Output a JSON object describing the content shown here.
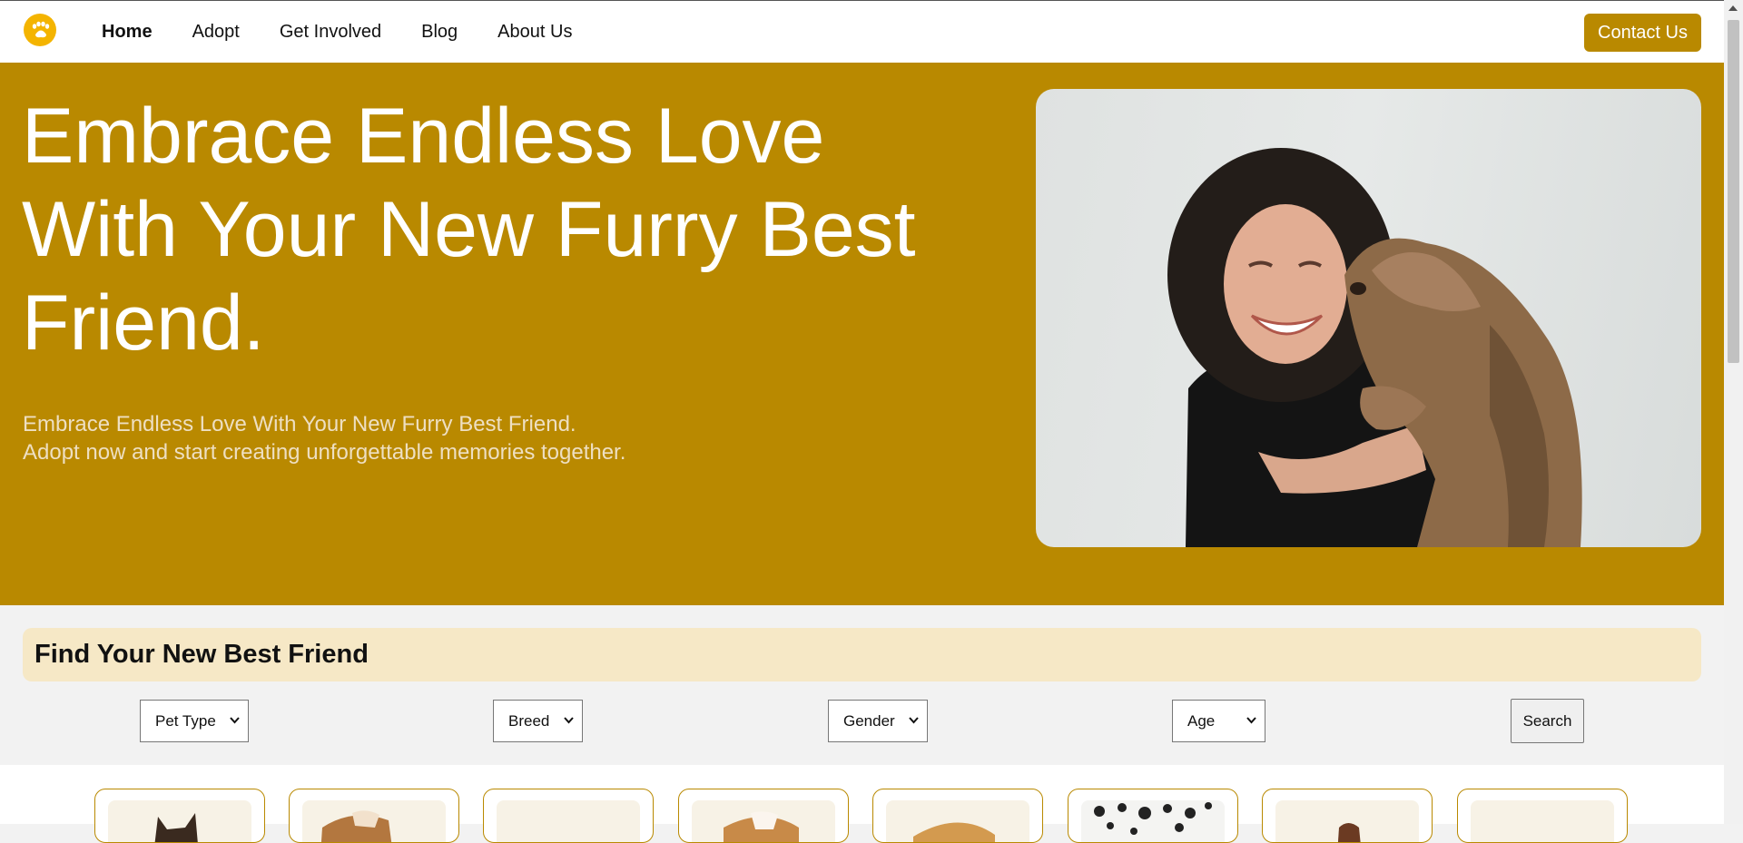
{
  "nav": {
    "logo_icon": "paw-icon",
    "links": [
      {
        "label": "Home",
        "active": true
      },
      {
        "label": "Adopt",
        "active": false
      },
      {
        "label": "Get Involved",
        "active": false
      },
      {
        "label": "Blog",
        "active": false
      },
      {
        "label": "About Us",
        "active": false
      }
    ],
    "contact_label": "Contact Us"
  },
  "hero": {
    "title": "Embrace Endless Love With Your New Furry Best Friend.",
    "subtitle_line1": "Embrace Endless Love With Your New Furry Best Friend.",
    "subtitle_line2": "Adopt now and start creating unforgettable memories together.",
    "photo": "woman-with-dog-photo"
  },
  "finder": {
    "title": "Find Your New Best Friend",
    "filters": [
      {
        "selected": "Pet Type"
      },
      {
        "selected": "Breed"
      },
      {
        "selected": "Gender"
      },
      {
        "selected": "Age"
      }
    ],
    "search_label": "Search"
  },
  "pet_cards": [
    {
      "image": "dog-photo-1"
    },
    {
      "image": "dog-photo-2"
    },
    {
      "image": "dog-photo-3"
    },
    {
      "image": "dog-photo-4"
    },
    {
      "image": "dog-photo-5"
    },
    {
      "image": "dalmatian-photo"
    },
    {
      "image": "dog-photo-7"
    },
    {
      "image": "dog-photo-8"
    }
  ],
  "colors": {
    "brand": "#b98900",
    "logo": "#f4b400",
    "finder_bar": "#f6e8c6",
    "subtitle": "#eedfc2"
  }
}
